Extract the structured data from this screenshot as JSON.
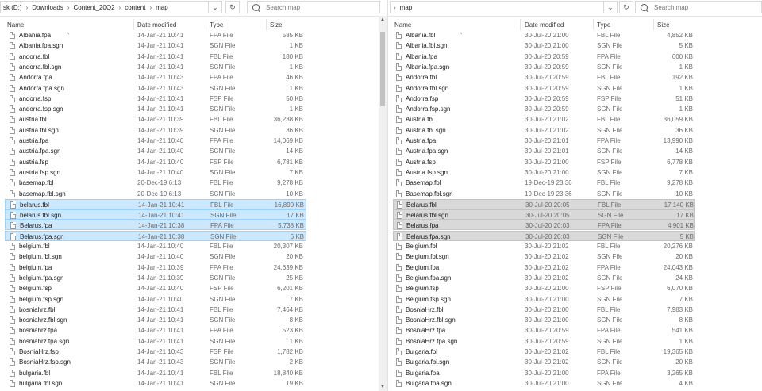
{
  "left": {
    "breadcrumb": [
      "sk (D:)",
      "Downloads",
      "Content_20Q2",
      "content",
      "map"
    ],
    "search_placeholder": "Search map",
    "columns": {
      "name": "Name",
      "date": "Date modified",
      "type": "Type",
      "size": "Size"
    },
    "files": [
      {
        "name": "Albania.fpa",
        "date": "14-Jan-21 10:41",
        "type": "FPA File",
        "size": "585 KB"
      },
      {
        "name": "Albania.fpa.sgn",
        "date": "14-Jan-21 10:41",
        "type": "SGN File",
        "size": "1 KB"
      },
      {
        "name": "andorra.fbl",
        "date": "14-Jan-21 10:41",
        "type": "FBL File",
        "size": "180 KB"
      },
      {
        "name": "andorra.fbl.sgn",
        "date": "14-Jan-21 10:41",
        "type": "SGN File",
        "size": "1 KB"
      },
      {
        "name": "Andorra.fpa",
        "date": "14-Jan-21 10:43",
        "type": "FPA File",
        "size": "46 KB"
      },
      {
        "name": "Andorra.fpa.sgn",
        "date": "14-Jan-21 10:43",
        "type": "SGN File",
        "size": "1 KB"
      },
      {
        "name": "andorra.fsp",
        "date": "14-Jan-21 10:41",
        "type": "FSP File",
        "size": "50 KB"
      },
      {
        "name": "andorra.fsp.sgn",
        "date": "14-Jan-21 10:41",
        "type": "SGN File",
        "size": "1 KB"
      },
      {
        "name": "austria.fbl",
        "date": "14-Jan-21 10:39",
        "type": "FBL File",
        "size": "36,238 KB"
      },
      {
        "name": "austria.fbl.sgn",
        "date": "14-Jan-21 10:39",
        "type": "SGN File",
        "size": "36 KB"
      },
      {
        "name": "austria.fpa",
        "date": "14-Jan-21 10:40",
        "type": "FPA File",
        "size": "14,069 KB"
      },
      {
        "name": "austria.fpa.sgn",
        "date": "14-Jan-21 10:40",
        "type": "SGN File",
        "size": "14 KB"
      },
      {
        "name": "austria.fsp",
        "date": "14-Jan-21 10:40",
        "type": "FSP File",
        "size": "6,781 KB"
      },
      {
        "name": "austria.fsp.sgn",
        "date": "14-Jan-21 10:40",
        "type": "SGN File",
        "size": "7 KB"
      },
      {
        "name": "basemap.fbl",
        "date": "20-Dec-19 6:13",
        "type": "FBL File",
        "size": "9,278 KB"
      },
      {
        "name": "basemap.fbl.sgn",
        "date": "20-Dec-19 6:13",
        "type": "SGN File",
        "size": "10 KB"
      },
      {
        "name": "belarus.fbl",
        "date": "14-Jan-21 10:41",
        "type": "FBL File",
        "size": "16,890 KB",
        "selected": true
      },
      {
        "name": "belarus.fbl.sgn",
        "date": "14-Jan-21 10:41",
        "type": "SGN File",
        "size": "17 KB",
        "selected": true
      },
      {
        "name": "Belarus.fpa",
        "date": "14-Jan-21 10:38",
        "type": "FPA File",
        "size": "5,738 KB",
        "selected": true
      },
      {
        "name": "Belarus.fpa.sgn",
        "date": "14-Jan-21 10:38",
        "type": "SGN File",
        "size": "6 KB",
        "selected": true
      },
      {
        "name": "belgium.fbl",
        "date": "14-Jan-21 10:40",
        "type": "FBL File",
        "size": "20,307 KB"
      },
      {
        "name": "belgium.fbl.sgn",
        "date": "14-Jan-21 10:40",
        "type": "SGN File",
        "size": "20 KB"
      },
      {
        "name": "belgium.fpa",
        "date": "14-Jan-21 10:39",
        "type": "FPA File",
        "size": "24,639 KB"
      },
      {
        "name": "belgium.fpa.sgn",
        "date": "14-Jan-21 10:39",
        "type": "SGN File",
        "size": "25 KB"
      },
      {
        "name": "belgium.fsp",
        "date": "14-Jan-21 10:40",
        "type": "FSP File",
        "size": "6,201 KB"
      },
      {
        "name": "belgium.fsp.sgn",
        "date": "14-Jan-21 10:40",
        "type": "SGN File",
        "size": "7 KB"
      },
      {
        "name": "bosniahrz.fbl",
        "date": "14-Jan-21 10:41",
        "type": "FBL File",
        "size": "7,464 KB"
      },
      {
        "name": "bosniahrz.fbl.sgn",
        "date": "14-Jan-21 10:41",
        "type": "SGN File",
        "size": "8 KB"
      },
      {
        "name": "bosniahrz.fpa",
        "date": "14-Jan-21 10:41",
        "type": "FPA File",
        "size": "523 KB"
      },
      {
        "name": "bosniahrz.fpa.sgn",
        "date": "14-Jan-21 10:41",
        "type": "SGN File",
        "size": "1 KB"
      },
      {
        "name": "BosniaHrz.fsp",
        "date": "14-Jan-21 10:43",
        "type": "FSP File",
        "size": "1,782 KB"
      },
      {
        "name": "BosniaHrz.fsp.sgn",
        "date": "14-Jan-21 10:43",
        "type": "SGN File",
        "size": "2 KB"
      },
      {
        "name": "bulgaria.fbl",
        "date": "14-Jan-21 10:41",
        "type": "FBL File",
        "size": "18,840 KB"
      },
      {
        "name": "bulgaria.fbl.sgn",
        "date": "14-Jan-21 10:41",
        "type": "SGN File",
        "size": "19 KB"
      }
    ]
  },
  "right": {
    "breadcrumb": [
      "map"
    ],
    "search_placeholder": "Search map",
    "columns": {
      "name": "Name",
      "date": "Date modified",
      "type": "Type",
      "size": "Size"
    },
    "files": [
      {
        "name": "Albania.fbl",
        "date": "30-Jul-20 21:00",
        "type": "FBL File",
        "size": "4,852 KB"
      },
      {
        "name": "Albania.fbl.sgn",
        "date": "30-Jul-20 21:00",
        "type": "SGN File",
        "size": "5 KB"
      },
      {
        "name": "Albania.fpa",
        "date": "30-Jul-20 20:59",
        "type": "FPA File",
        "size": "600 KB"
      },
      {
        "name": "Albania.fpa.sgn",
        "date": "30-Jul-20 20:59",
        "type": "SGN File",
        "size": "1 KB"
      },
      {
        "name": "Andorra.fbl",
        "date": "30-Jul-20 20:59",
        "type": "FBL File",
        "size": "192 KB"
      },
      {
        "name": "Andorra.fbl.sgn",
        "date": "30-Jul-20 20:59",
        "type": "SGN File",
        "size": "1 KB"
      },
      {
        "name": "Andorra.fsp",
        "date": "30-Jul-20 20:59",
        "type": "FSP File",
        "size": "51 KB"
      },
      {
        "name": "Andorra.fsp.sgn",
        "date": "30-Jul-20 20:59",
        "type": "SGN File",
        "size": "1 KB"
      },
      {
        "name": "Austria.fbl",
        "date": "30-Jul-20 21:02",
        "type": "FBL File",
        "size": "36,059 KB"
      },
      {
        "name": "Austria.fbl.sgn",
        "date": "30-Jul-20 21:02",
        "type": "SGN File",
        "size": "36 KB"
      },
      {
        "name": "Austria.fpa",
        "date": "30-Jul-20 21:01",
        "type": "FPA File",
        "size": "13,990 KB"
      },
      {
        "name": "Austria.fpa.sgn",
        "date": "30-Jul-20 21:01",
        "type": "SGN File",
        "size": "14 KB"
      },
      {
        "name": "Austria.fsp",
        "date": "30-Jul-20 21:00",
        "type": "FSP File",
        "size": "6,778 KB"
      },
      {
        "name": "Austria.fsp.sgn",
        "date": "30-Jul-20 21:00",
        "type": "SGN File",
        "size": "7 KB"
      },
      {
        "name": "Basemap.fbl",
        "date": "19-Dec-19 23:36",
        "type": "FBL File",
        "size": "9,278 KB"
      },
      {
        "name": "Basemap.fbl.sgn",
        "date": "19-Dec-19 23:36",
        "type": "SGN File",
        "size": "10 KB"
      },
      {
        "name": "Belarus.fbl",
        "date": "30-Jul-20 20:05",
        "type": "FBL File",
        "size": "17,140 KB",
        "selected": true
      },
      {
        "name": "Belarus.fbl.sgn",
        "date": "30-Jul-20 20:05",
        "type": "SGN File",
        "size": "17 KB",
        "selected": true
      },
      {
        "name": "Belarus.fpa",
        "date": "30-Jul-20 20:03",
        "type": "FPA File",
        "size": "4,901 KB",
        "selected": true
      },
      {
        "name": "Belarus.fpa.sgn",
        "date": "30-Jul-20 20:03",
        "type": "SGN File",
        "size": "5 KB",
        "selected": true
      },
      {
        "name": "Belgium.fbl",
        "date": "30-Jul-20 21:02",
        "type": "FBL File",
        "size": "20,276 KB"
      },
      {
        "name": "Belgium.fbl.sgn",
        "date": "30-Jul-20 21:02",
        "type": "SGN File",
        "size": "20 KB"
      },
      {
        "name": "Belgium.fpa",
        "date": "30-Jul-20 21:02",
        "type": "FPA File",
        "size": "24,043 KB"
      },
      {
        "name": "Belgium.fpa.sgn",
        "date": "30-Jul-20 21:02",
        "type": "SGN File",
        "size": "24 KB"
      },
      {
        "name": "Belgium.fsp",
        "date": "30-Jul-20 21:00",
        "type": "FSP File",
        "size": "6,070 KB"
      },
      {
        "name": "Belgium.fsp.sgn",
        "date": "30-Jul-20 21:00",
        "type": "SGN File",
        "size": "7 KB"
      },
      {
        "name": "BosniaHrz.fbl",
        "date": "30-Jul-20 21:00",
        "type": "FBL File",
        "size": "7,983 KB"
      },
      {
        "name": "BosniaHrz.fbl.sgn",
        "date": "30-Jul-20 21:00",
        "type": "SGN File",
        "size": "8 KB"
      },
      {
        "name": "BosniaHrz.fpa",
        "date": "30-Jul-20 20:59",
        "type": "FPA File",
        "size": "541 KB"
      },
      {
        "name": "BosniaHrz.fpa.sgn",
        "date": "30-Jul-20 20:59",
        "type": "SGN File",
        "size": "1 KB"
      },
      {
        "name": "Bulgaria.fbl",
        "date": "30-Jul-20 21:02",
        "type": "FBL File",
        "size": "19,365 KB"
      },
      {
        "name": "Bulgaria.fbl.sgn",
        "date": "30-Jul-20 21:02",
        "type": "SGN File",
        "size": "20 KB"
      },
      {
        "name": "Bulgaria.fpa",
        "date": "30-Jul-20 21:00",
        "type": "FPA File",
        "size": "3,265 KB"
      },
      {
        "name": "Bulgaria.fpa.sgn",
        "date": "30-Jul-20 21:00",
        "type": "SGN File",
        "size": "4 KB"
      }
    ]
  }
}
